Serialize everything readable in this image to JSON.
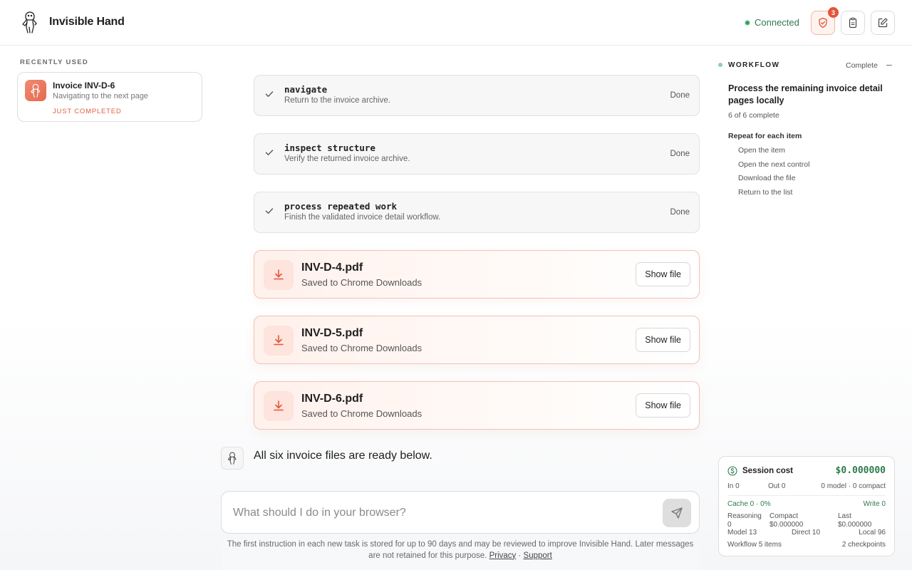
{
  "app": {
    "title": "Invisible Hand"
  },
  "header": {
    "connection_status": "Connected",
    "shield_badge_count": "3"
  },
  "sidebar": {
    "section_label": "RECENTLY USED",
    "recent": [
      {
        "title": "Invoice INV-D-6",
        "subtitle": "Navigating to the next page",
        "status": "JUST COMPLETED"
      }
    ]
  },
  "steps": [
    {
      "title": "navigate",
      "description": "Return to the invoice archive.",
      "status": "Done"
    },
    {
      "title": "inspect structure",
      "description": "Verify the returned invoice archive.",
      "status": "Done"
    },
    {
      "title": "process repeated work",
      "description": "Finish the validated invoice detail workflow.",
      "status": "Done"
    }
  ],
  "files": [
    {
      "name": "INV-D-4.pdf",
      "location": "Saved to Chrome Downloads",
      "action": "Show file"
    },
    {
      "name": "INV-D-5.pdf",
      "location": "Saved to Chrome Downloads",
      "action": "Show file"
    },
    {
      "name": "INV-D-6.pdf",
      "location": "Saved to Chrome Downloads",
      "action": "Show file"
    }
  ],
  "assistant_message": "All six invoice files are ready below.",
  "composer": {
    "placeholder": "What should I do in your browser?"
  },
  "disclaimer": {
    "text": "The first instruction in each new task is stored for up to 90 days and may be reviewed to improve Invisible Hand. Later messages are not retained for this purpose.",
    "privacy": "Privacy",
    "separator": "·",
    "support": "Support"
  },
  "workflow": {
    "label": "WORKFLOW",
    "status": "Complete",
    "collapse": "–",
    "title": "Process the remaining invoice detail pages locally",
    "progress": "6 of 6 complete",
    "repeat_label": "Repeat for each item",
    "steps": [
      "Open the item",
      "Open the next control",
      "Download the file",
      "Return to the list"
    ]
  },
  "session_cost": {
    "title": "Session cost",
    "total": "$0.000000",
    "in": "In 0",
    "out": "Out 0",
    "model_compact": "0 model · 0 compact",
    "cache": "Cache 0 · 0%",
    "write": "Write 0",
    "reasoning_label": "Reasoning",
    "reasoning_value": "0",
    "compact_label": "Compact",
    "compact_value": "$0.000000",
    "last_label": "Last",
    "last_value": "$0.000000",
    "model": "Model 13",
    "direct": "Direct 10",
    "local": "Local 96",
    "workflow_items": "Workflow 5 items",
    "checkpoints": "2 checkpoints"
  },
  "colors": {
    "accent": "#e4553a",
    "success": "#2f7a4d"
  }
}
